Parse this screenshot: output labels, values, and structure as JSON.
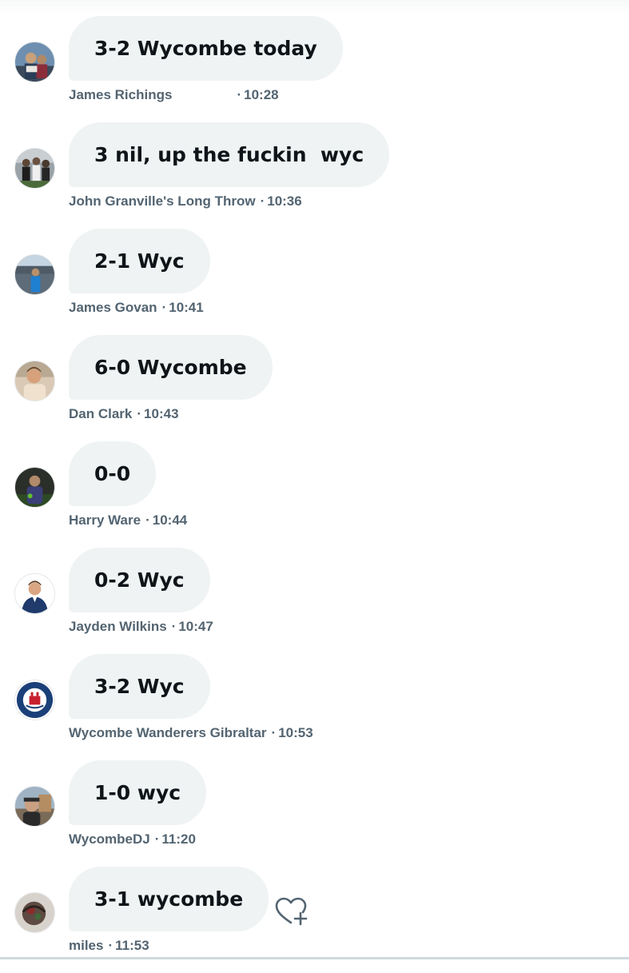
{
  "messages": [
    {
      "text": "3-2 Wycombe today",
      "author": "James Richings",
      "flags": [
        "england-flag",
        "uk-flag",
        "malaysia-flag"
      ],
      "separator": "·",
      "time": "10:28"
    },
    {
      "text": "3 nil, up the fuckin  wyc",
      "author": "John Granville's Long Throw",
      "separator": "·",
      "time": "10:36"
    },
    {
      "text": "2-1 Wyc",
      "author": "James Govan",
      "separator": "·",
      "time": "10:41"
    },
    {
      "text": "6-0 Wycombe",
      "author": "Dan Clark",
      "separator": "·",
      "time": "10:43"
    },
    {
      "text": "0-0",
      "author": "Harry Ware",
      "separator": "·",
      "time": "10:44"
    },
    {
      "text": "0-2 Wyc",
      "author": "Jayden Wilkins",
      "separator": "·",
      "time": "10:47"
    },
    {
      "text": "3-2 Wyc",
      "author": "Wycombe Wanderers Gibraltar",
      "separator": "·",
      "time": "10:53"
    },
    {
      "text": "1-0 wyc",
      "author": "WycombeDJ",
      "separator": "·",
      "time": "11:20"
    },
    {
      "text": "3-1 wycombe",
      "author": "miles",
      "separator": "·",
      "time": "11:53"
    }
  ],
  "icons": {
    "like": "heart-plus-icon"
  },
  "colors": {
    "bubble": "#eff3f4",
    "text": "#0f1419",
    "meta": "#536471"
  }
}
